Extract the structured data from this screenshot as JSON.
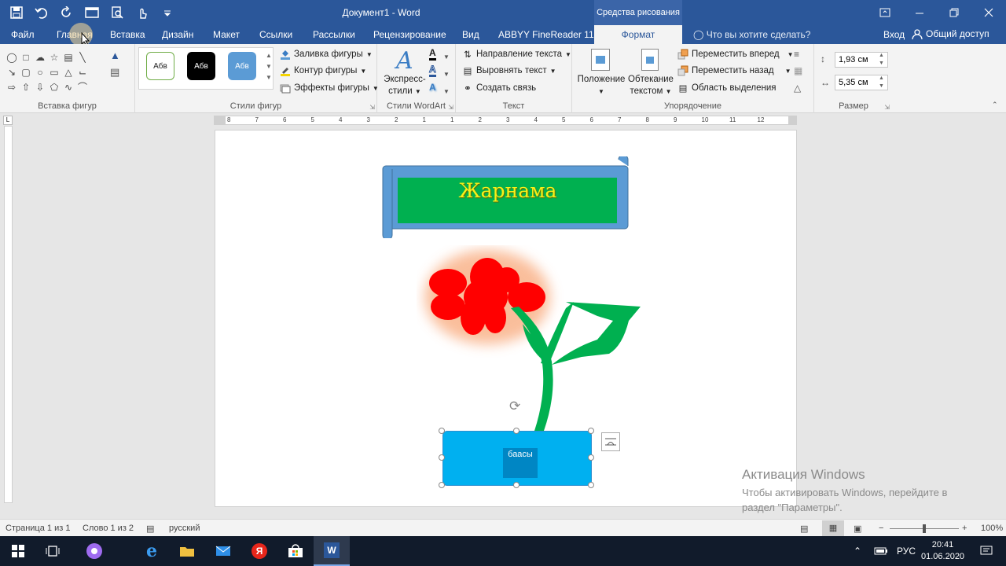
{
  "titlebar": {
    "title": "Документ1 - Word",
    "tools_header": "Средства рисования"
  },
  "tabs": [
    "Файл",
    "Главная",
    "Вставка",
    "Дизайн",
    "Макет",
    "Ссылки",
    "Рассылки",
    "Рецензирование",
    "Вид",
    "ABBYY FineReader 11",
    "Формат"
  ],
  "active_tab": "Формат",
  "tell_me": "Что вы хотите сделать?",
  "signin": "Вход",
  "share": "Общий доступ",
  "ribbon": {
    "groups": {
      "insert_shapes": "Вставка фигур",
      "shape_styles": "Стили фигур",
      "wordart_styles": "Стили WordArt",
      "text": "Текст",
      "arrange": "Упорядочение",
      "size": "Размер"
    },
    "style_sample": "Абв",
    "fill": "Заливка фигуры",
    "outline": "Контур фигуры",
    "effects": "Эффекты фигуры",
    "express_styles_1": "Экспресс-",
    "express_styles_2": "стили",
    "text_direction": "Направление текста",
    "align_text": "Выровнять текст",
    "create_link": "Создать связь",
    "position": "Положение",
    "wrap_1": "Обтекание",
    "wrap_2": "текстом",
    "bring_forward": "Переместить вперед",
    "send_backward": "Переместить назад",
    "selection_pane": "Область выделения",
    "height": "1,93 см",
    "width": "5,35 см"
  },
  "document": {
    "banner_text": "Жарнама",
    "vase_text": "баасы"
  },
  "ruler_numbers": [
    "8",
    "7",
    "6",
    "5",
    "4",
    "3",
    "2",
    "1",
    "1",
    "2",
    "3",
    "4",
    "5",
    "6",
    "7",
    "8",
    "9",
    "10",
    "11",
    "12"
  ],
  "activation": {
    "title": "Активация Windows",
    "line1": "Чтобы активировать Windows, перейдите в",
    "line2": "раздел \"Параметры\"."
  },
  "status": {
    "page": "Страница 1 из 1",
    "words": "Слово 1 из 2",
    "language": "русский",
    "zoom": "100%"
  },
  "taskbar": {
    "lang": "РУС",
    "time": "20:41",
    "date": "01.06.2020"
  },
  "colors": {
    "word_blue": "#2b579a",
    "banner_scroll": "#5b9bd5",
    "banner_fill": "#00b050",
    "banner_text": "#f7f019",
    "petal": "#ff0000",
    "stem": "#00b050",
    "vase": "#00b0f0"
  }
}
